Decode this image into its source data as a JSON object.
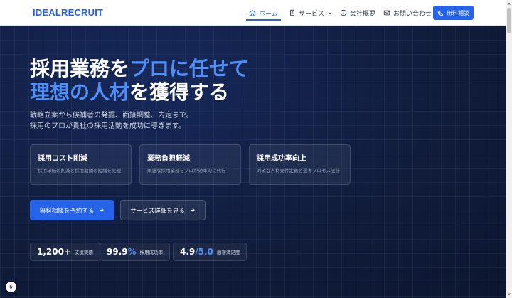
{
  "header": {
    "logo": "IDEALRECRUIT",
    "nav": [
      {
        "label": "ホーム",
        "icon": "home-icon",
        "active": true
      },
      {
        "label": "サービス",
        "icon": "document-icon",
        "dropdown": true
      },
      {
        "label": "会社概要",
        "icon": "info-icon"
      },
      {
        "label": "お問い合わせ",
        "icon": "mail-icon"
      }
    ],
    "cta_label": "無料相談",
    "cta_icon": "phone-icon"
  },
  "hero": {
    "headline_line1_white": "採用業務を",
    "headline_line1_accent": "プロに任せて",
    "headline_line2_accent": "理想の人材",
    "headline_line2_white": "を獲得する",
    "subtitle_line1": "戦略立案から候補者の発掘、面接調整、内定まで。",
    "subtitle_line2": "採用のプロが貴社の採用活動を成功に導きます。",
    "features": [
      {
        "title": "採用コスト削減",
        "desc": "採用単価の削減と採用期間の短縮を実現"
      },
      {
        "title": "業務負担軽減",
        "desc": "煩雑な採用業務をプロが効率的に代行"
      },
      {
        "title": "採用成功率向上",
        "desc": "的確な人材要件定義と選考プロセス設計"
      }
    ],
    "primary_button": "無料相談を予約する",
    "secondary_button": "サービス詳細を見る",
    "stats": [
      {
        "value": "1,200+",
        "label": "支援実績"
      },
      {
        "value_main": "99.9",
        "value_accent": "%",
        "label": "採用成功率"
      },
      {
        "value_main": "4.9",
        "value_accent": "/5.0",
        "label": "顧客満足度"
      }
    ]
  },
  "colors": {
    "accent": "#2563eb",
    "accent_light": "#4f8ff7",
    "hero_bg": "#101c3a"
  }
}
